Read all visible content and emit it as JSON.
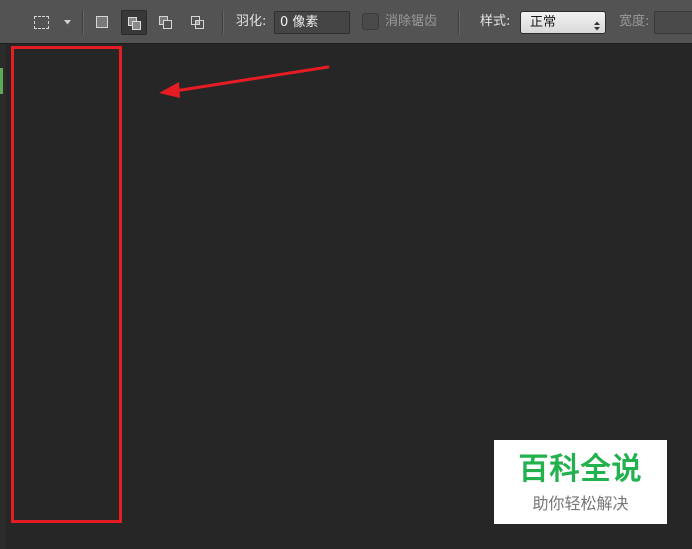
{
  "toolbar": {
    "feather_label": "羽化:",
    "feather_value": "0 像素",
    "antialias_label": "消除锯齿",
    "style_label": "样式:",
    "style_value": "正常",
    "width_label": "宽度:"
  },
  "icons": {
    "marquee": "rectangular-marquee-icon",
    "preset_caret": "chevron-down-icon",
    "new_selection": "new-selection-icon",
    "add_selection": "add-to-selection-icon",
    "subtract_selection": "subtract-from-selection-icon",
    "intersect_selection": "intersect-selection-icon",
    "select_arrows": "up-down-arrows-icon"
  },
  "watermark": {
    "title": "百科全说",
    "subtitle": "助你轻松解决"
  },
  "colors": {
    "annotation": "#e51c23",
    "watermark_green": "#22b14c",
    "toolbar_bg": "#535353",
    "canvas_bg": "#262626"
  }
}
